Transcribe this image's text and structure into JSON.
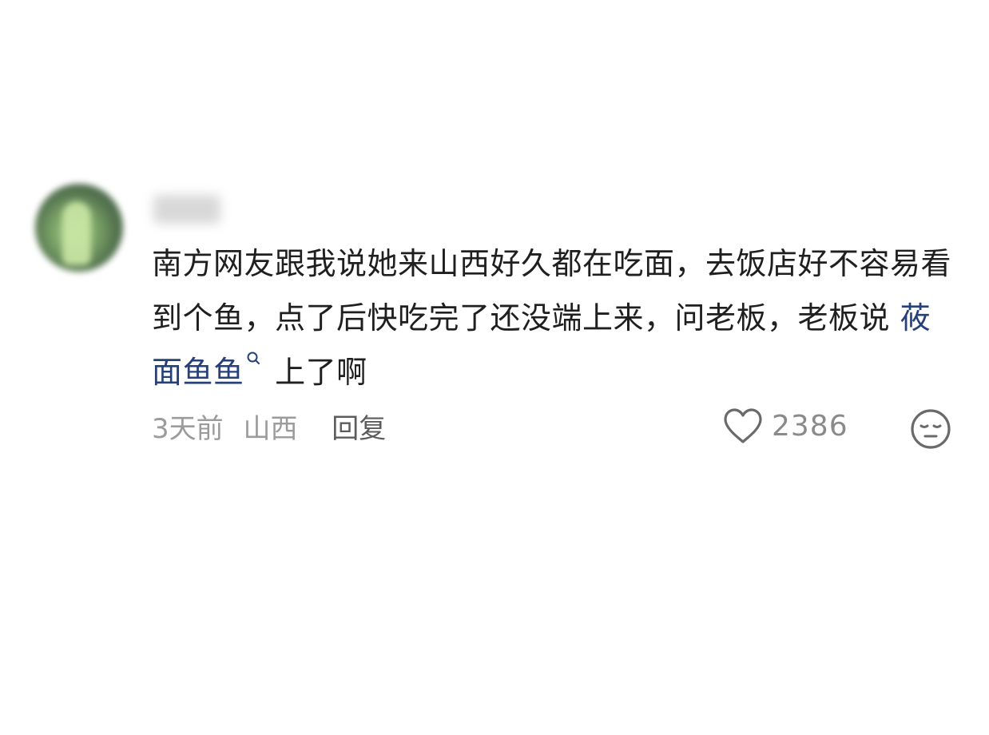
{
  "comment": {
    "body_part1": "南方网友跟我说她来山西好久都在吃面，去饭店好不容易看到个鱼，点了后快吃完了还没端上来，问老板，老板说 ",
    "link_text": "莜面鱼鱼",
    "body_part2": " 上了啊",
    "time": "3天前",
    "location": "山西",
    "reply_label": "回复",
    "like_count": "2386"
  },
  "icons": {
    "search": "search-icon",
    "heart": "heart-icon",
    "dislike": "dislike-face-icon"
  },
  "colors": {
    "link": "#26407a",
    "text": "#1f1f1f",
    "muted": "#9b9b9b"
  }
}
